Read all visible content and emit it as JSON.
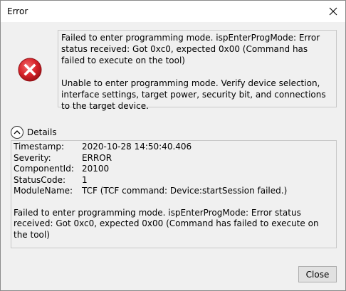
{
  "window": {
    "title": "Error",
    "close_icon": "close-icon"
  },
  "message": {
    "icon": "error-icon",
    "paragraph1": "Failed to enter programming mode. ispEnterProgMode: Error status received: Got 0xc0, expected 0x00 (Command has failed to execute on the tool)",
    "paragraph2": "Unable to enter programming mode. Verify device selection, interface settings, target power, security bit, and connections to the target device."
  },
  "details": {
    "toggle_label": "Details",
    "toggle_icon": "chevron-up-icon",
    "rows": [
      {
        "key": "Timestamp:",
        "value": "2020-10-28 14:50:40.406"
      },
      {
        "key": "Severity:",
        "value": "ERROR"
      },
      {
        "key": "ComponentId:",
        "value": "20100"
      },
      {
        "key": "StatusCode:",
        "value": "1"
      },
      {
        "key": "ModuleName:",
        "value": "TCF (TCF command: Device:startSession failed.)"
      }
    ],
    "message": "Failed to enter programming mode. ispEnterProgMode: Error status received: Got 0xc0, expected 0x00 (Command has failed to execute on the tool)"
  },
  "buttons": {
    "close_label": "Close"
  },
  "colors": {
    "error_red": "#d8232a",
    "window_bg": "#f0f0f0",
    "titlebar_bg": "#ffffff"
  }
}
